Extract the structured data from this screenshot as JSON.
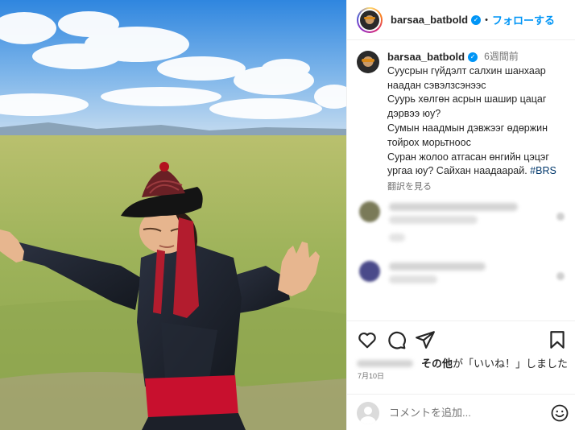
{
  "post": {
    "username": "barsaa_batbold",
    "verified_glyph": "✓",
    "dot": "•",
    "follow_label": "フォローする"
  },
  "caption": {
    "username": "barsaa_batbold",
    "time": "6週間前",
    "text": "Суусрын гүйдэлт салхин шанхаар\nнаадан сэвэлзсэнээс\nСуурь хөлгөн асрын шашир цацаг\nдэрвээ юу?\nСумын наадмын дэвжээг өдөржин\nтойрох морьтноос\nСуран жолоо атгасан өнгийн цэцэг\nургаа юу? Сайхан наадаарай. ",
    "hashtag": "#BRS",
    "translate_label": "翻訳を見る"
  },
  "comments": [
    {
      "avatar_color": "#7a7a58"
    },
    {
      "avatar_color": "#4a4a8a"
    }
  ],
  "actions": {
    "icons": [
      "heart-icon",
      "comment-icon",
      "share-icon",
      "bookmark-icon"
    ],
    "likes_suffix": "その他",
    "likes_middle": "が「いいね！」しました",
    "date": "7月10日"
  },
  "add_comment": {
    "placeholder": "コメントを追加..."
  },
  "colors": {
    "accent": "#0095f6",
    "belt": "#c8102e",
    "robe": "#1f2530",
    "sky": "#3f8fe0"
  }
}
